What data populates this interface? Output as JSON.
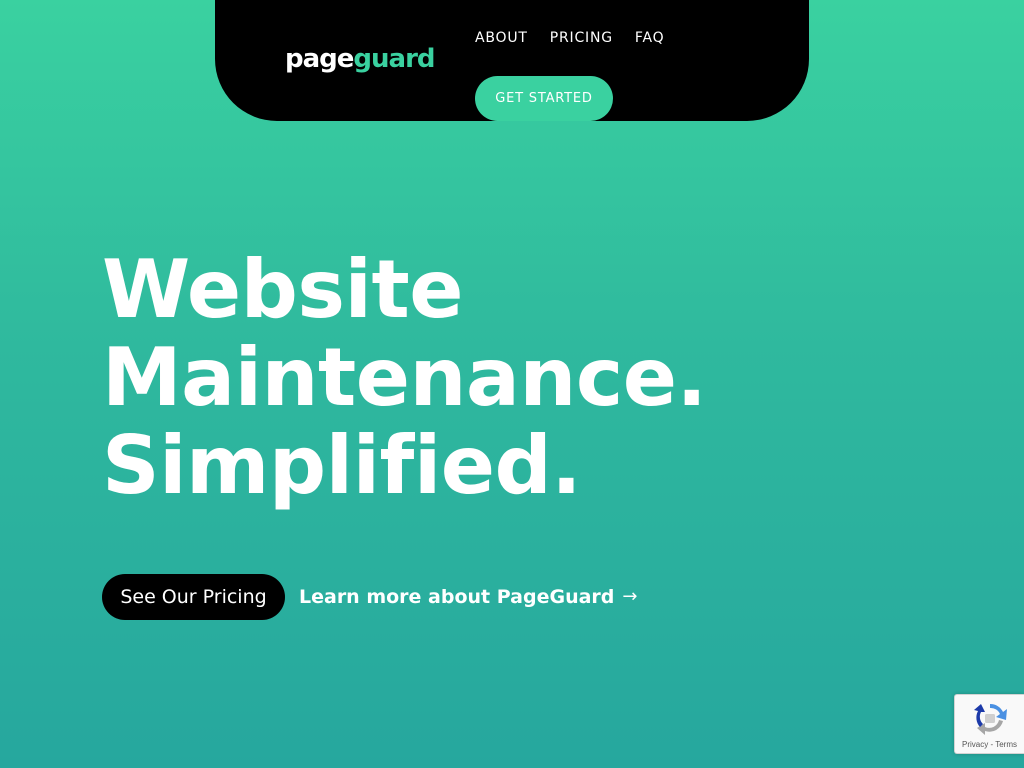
{
  "header": {
    "logo": {
      "part1": "page",
      "part2": "guard"
    },
    "nav": [
      {
        "label": "ABOUT"
      },
      {
        "label": "PRICING"
      },
      {
        "label": "FAQ"
      }
    ],
    "cta_label": "GET STARTED"
  },
  "hero": {
    "headline_lines": [
      "Website",
      "Maintenance.",
      "Simplified."
    ],
    "primary_button": "See Our Pricing",
    "secondary_link": "Learn more about PageGuard",
    "secondary_link_arrow": "→"
  },
  "recaptcha": {
    "privacy": "Privacy",
    "separator": " - ",
    "terms": "Terms"
  },
  "colors": {
    "accent": "#3ad1a0",
    "navbar": "#000000",
    "background_top": "#3ad1a0",
    "background_bottom": "#26a79e"
  }
}
